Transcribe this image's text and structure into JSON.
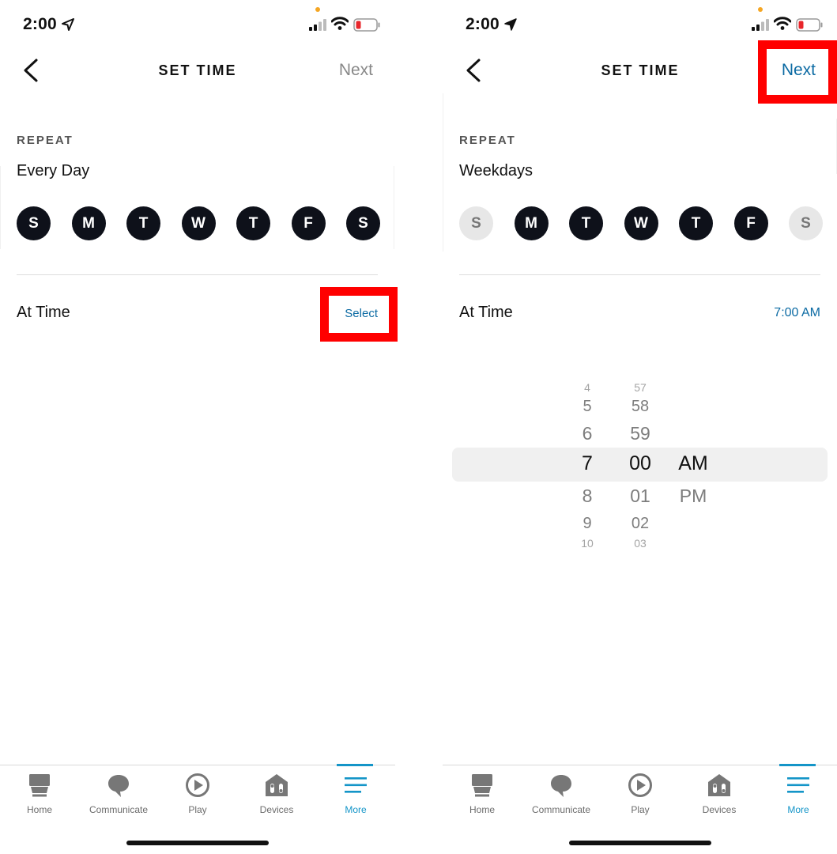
{
  "status": {
    "time": "2:00"
  },
  "left": {
    "title": "SET TIME",
    "next_label": "Next",
    "repeat_label": "REPEAT",
    "repeat_value": "Every Day",
    "days": [
      {
        "letter": "S",
        "selected": true
      },
      {
        "letter": "M",
        "selected": true
      },
      {
        "letter": "T",
        "selected": true
      },
      {
        "letter": "W",
        "selected": true
      },
      {
        "letter": "T",
        "selected": true
      },
      {
        "letter": "F",
        "selected": true
      },
      {
        "letter": "S",
        "selected": true
      }
    ],
    "at_time_label": "At Time",
    "select_label": "Select"
  },
  "right": {
    "title": "SET TIME",
    "next_label": "Next",
    "repeat_label": "REPEAT",
    "repeat_value": "Weekdays",
    "days": [
      {
        "letter": "S",
        "selected": false
      },
      {
        "letter": "M",
        "selected": true
      },
      {
        "letter": "T",
        "selected": true
      },
      {
        "letter": "W",
        "selected": true
      },
      {
        "letter": "T",
        "selected": true
      },
      {
        "letter": "F",
        "selected": true
      },
      {
        "letter": "S",
        "selected": false
      }
    ],
    "at_time_label": "At Time",
    "time_value": "7:00 AM",
    "picker": {
      "hours": [
        "4",
        "5",
        "6",
        "7",
        "8",
        "9",
        "10"
      ],
      "minutes": [
        "57",
        "58",
        "59",
        "00",
        "01",
        "02",
        "03"
      ],
      "periods": [
        "AM",
        "PM"
      ],
      "selected": {
        "hour": "7",
        "minute": "00",
        "period": "AM"
      }
    }
  },
  "tabs": [
    {
      "label": "Home",
      "icon": "home-icon",
      "active": false
    },
    {
      "label": "Communicate",
      "icon": "communicate-icon",
      "active": false
    },
    {
      "label": "Play",
      "icon": "play-icon",
      "active": false
    },
    {
      "label": "Devices",
      "icon": "devices-icon",
      "active": false
    },
    {
      "label": "More",
      "icon": "more-icon",
      "active": true
    }
  ],
  "colors": {
    "accent": "#0b6aa3",
    "tab_active": "#1495c8",
    "day_selected": "#0e111a",
    "day_unselected": "#e7e7e7",
    "highlight": "#ff0000"
  }
}
